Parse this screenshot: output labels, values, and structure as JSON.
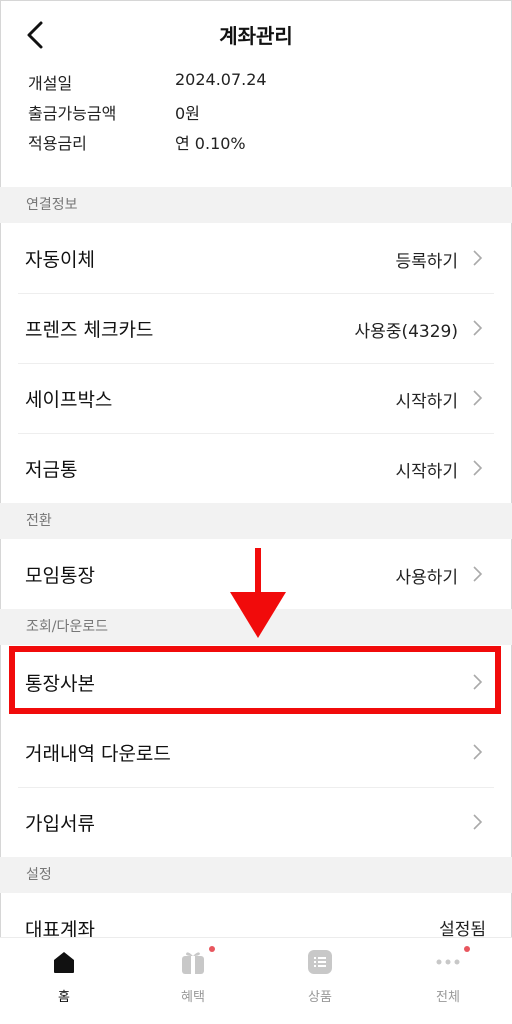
{
  "header": {
    "title": "계좌관리"
  },
  "info": [
    {
      "key": "개설일",
      "value": "2024.07.24"
    },
    {
      "key": "출금가능금액",
      "value": "0원"
    },
    {
      "key": "적용금리",
      "value": "연 0.10%"
    }
  ],
  "sections": {
    "link": "연결정보",
    "convert": "전환",
    "lookup": "조회/다운로드",
    "settings": "설정"
  },
  "rows": {
    "auto_transfer": {
      "label": "자동이체",
      "value": "등록하기"
    },
    "friends_card": {
      "label": "프렌즈 체크카드",
      "value": "사용중(4329)"
    },
    "safe_box": {
      "label": "세이프박스",
      "value": "시작하기"
    },
    "savings_box": {
      "label": "저금통",
      "value": "시작하기"
    },
    "group_account": {
      "label": "모임통장",
      "value": "사용하기"
    },
    "passbook_copy": {
      "label": "통장사본"
    },
    "history_download": {
      "label": "거래내역 다운로드"
    },
    "join_documents": {
      "label": "가입서류"
    },
    "main_account": {
      "label": "대표계좌",
      "value": "설정됨"
    }
  },
  "tabbar": {
    "home": "홈",
    "benefits": "혜택",
    "products": "상품",
    "all": "전체"
  },
  "colors": {
    "highlight": "#f10b0b",
    "badge": "#e8565e",
    "section_bg": "#f2f2f2"
  }
}
